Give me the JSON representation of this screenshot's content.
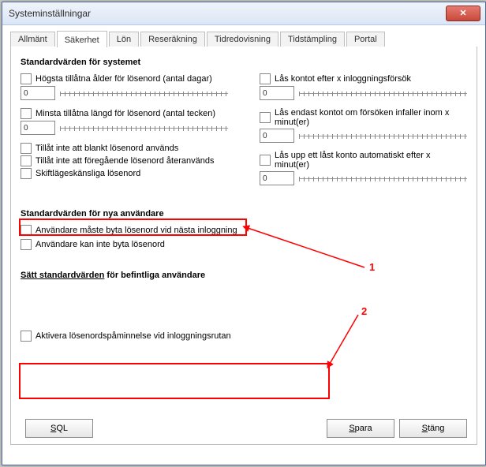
{
  "window": {
    "title": "Systeminställningar"
  },
  "tabs": {
    "items": [
      {
        "label": "Allmänt"
      },
      {
        "label": "Säkerhet"
      },
      {
        "label": "Lön"
      },
      {
        "label": "Reseräkning"
      },
      {
        "label": "Tidredovisning"
      },
      {
        "label": "Tidstämpling"
      },
      {
        "label": "Portal"
      }
    ],
    "active_index": 1
  },
  "sections": {
    "system_defaults": {
      "title": "Standardvärden för systemet",
      "left": {
        "max_age": {
          "label": "Högsta tillåtna ålder för lösenord (antal dagar)",
          "value": "0"
        },
        "min_len": {
          "label": "Minsta tillåtna längd för lösenord (antal tecken)",
          "value": "0"
        },
        "no_blank": {
          "label": "Tillåt inte att blankt lösenord används"
        },
        "no_prev": {
          "label": "Tillåt inte att föregående lösenord återanvänds"
        },
        "case_sensitive": {
          "label": "Skiftlägeskänsliga lösenord"
        }
      },
      "right": {
        "lock_after": {
          "label": "Lås kontot efter x inloggningsförsök",
          "value": "0"
        },
        "lock_only_within": {
          "label": "Lås endast kontot om försöken infaller inom x minut(er)",
          "value": "0"
        },
        "unlock_after": {
          "label": "Lås upp ett låst konto automatiskt efter x minut(er)",
          "value": "0"
        }
      }
    },
    "new_user_defaults": {
      "title": "Standardvärden för nya användare",
      "must_change": "Användare måste byta lösenord vid nästa inloggning",
      "cannot_change": "Användare kan inte byta lösenord"
    },
    "set_defaults_link": {
      "bold_part": "Sätt standardvärden",
      "rest": " för befintliga användare"
    },
    "reminder": {
      "label": "Aktivera lösenordspåminnelse vid inloggningsrutan"
    }
  },
  "annotations": {
    "one": "1",
    "two": "2"
  },
  "footer": {
    "sql_prefix": "S",
    "sql_rest": "QL",
    "save_prefix": "S",
    "save_rest": "para",
    "close_prefix": "S",
    "close_rest": "täng"
  }
}
